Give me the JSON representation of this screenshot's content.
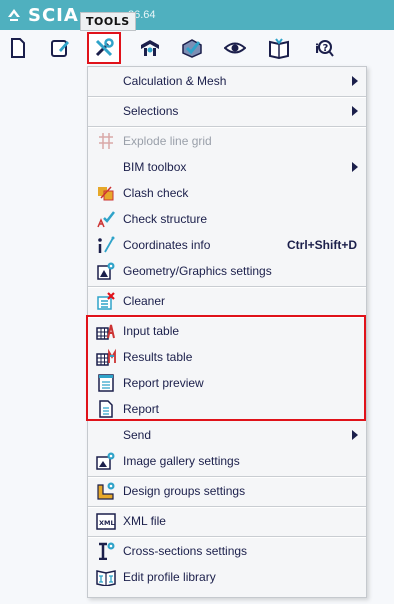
{
  "app": {
    "logo_text": "SCIA",
    "version_fragment": "26.64"
  },
  "tooltip": {
    "label": "TOOLS"
  },
  "toolbar": {
    "buttons": [
      {
        "icon": "new-file-icon"
      },
      {
        "icon": "edit-icon"
      },
      {
        "icon": "tools-icon",
        "active": true
      },
      {
        "icon": "structure-icon"
      },
      {
        "icon": "check-icon"
      },
      {
        "icon": "view-icon"
      },
      {
        "icon": "book-icon"
      },
      {
        "icon": "help-icon"
      }
    ]
  },
  "menu": {
    "items": [
      {
        "label": "Calculation & Mesh",
        "submenu": true
      },
      {
        "label": "Selections",
        "submenu": true
      },
      {
        "label": "Explode line grid",
        "disabled": true,
        "icon": "explode-grid-icon"
      },
      {
        "label": "BIM toolbox",
        "submenu": true
      },
      {
        "label": "Clash check",
        "icon": "clash-check-icon"
      },
      {
        "label": "Check structure",
        "icon": "check-structure-icon"
      },
      {
        "label": "Coordinates info",
        "shortcut": "Ctrl+Shift+D",
        "icon": "coordinates-info-icon"
      },
      {
        "label": "Geometry/Graphics settings",
        "icon": "geometry-settings-icon"
      },
      {
        "label": "Cleaner",
        "icon": "cleaner-icon"
      },
      {
        "label": "Input table",
        "icon": "input-table-icon"
      },
      {
        "label": "Results table",
        "icon": "results-table-icon"
      },
      {
        "label": "Report preview",
        "icon": "report-preview-icon"
      },
      {
        "label": "Report",
        "icon": "report-icon"
      },
      {
        "label": "Send",
        "submenu": true
      },
      {
        "label": "Image gallery settings",
        "icon": "image-gallery-icon"
      },
      {
        "label": "Design groups settings",
        "icon": "design-groups-icon"
      },
      {
        "label": "XML file",
        "icon": "xml-file-icon"
      },
      {
        "label": "Cross-sections settings",
        "icon": "cross-sections-icon"
      },
      {
        "label": "Edit profile library",
        "icon": "profile-library-icon"
      }
    ]
  },
  "colors": {
    "title_bar": "#4fb0bf",
    "highlight": "#e0121a",
    "menu_text": "#1b1f4b"
  }
}
